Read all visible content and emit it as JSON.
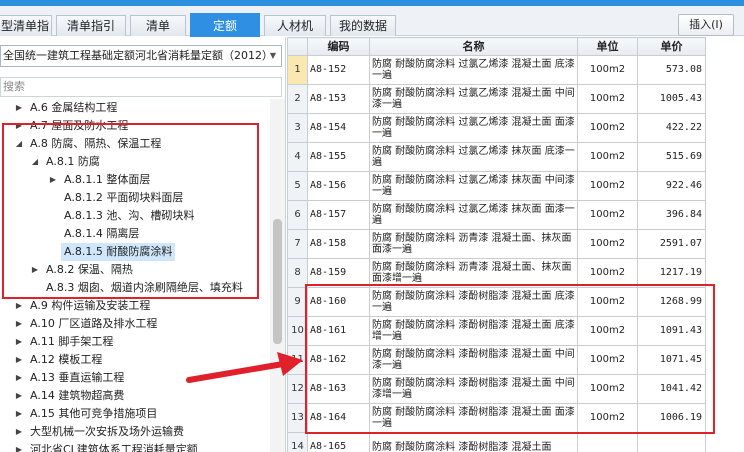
{
  "tabs": [
    {
      "label": "型清单指引",
      "active": false
    },
    {
      "label": "清单指引",
      "active": false
    },
    {
      "label": "清单",
      "active": false
    },
    {
      "label": "定额",
      "active": true
    },
    {
      "label": "人材机",
      "active": false
    },
    {
      "label": "我的数据",
      "active": false
    }
  ],
  "toolbar": {
    "insert_label": "插入(I)"
  },
  "library": {
    "selected": "全国统一建筑工程基础定额河北省消耗量定额（2012）"
  },
  "search": {
    "placeholder": "搜索"
  },
  "tree": [
    {
      "label": "A.6 金属结构工程",
      "toggle": "▶"
    },
    {
      "label": "A.7 屋面及防水工程",
      "toggle": "▶"
    },
    {
      "label": "A.8 防腐、隔热、保温工程",
      "toggle": "◢"
    },
    {
      "label": "A.8.1 防腐",
      "toggle": "◢"
    },
    {
      "label": "A.8.1.1 整体面层",
      "toggle": "▶"
    },
    {
      "label": "A.8.1.2 平面砌块料面层",
      "toggle": ""
    },
    {
      "label": "A.8.1.3 池、沟、槽砌块料",
      "toggle": ""
    },
    {
      "label": "A.8.1.4 隔离层",
      "toggle": ""
    },
    {
      "label": "A.8.1.5 耐酸防腐涂料",
      "toggle": "",
      "selected": true
    },
    {
      "label": "A.8.2 保温、隔热",
      "toggle": "▶"
    },
    {
      "label": "A.8.3 烟囱、烟道内涂刷隔绝层、填充料",
      "toggle": ""
    },
    {
      "label": "A.9 构件运输及安装工程",
      "toggle": "▶"
    },
    {
      "label": "A.10 厂区道路及排水工程",
      "toggle": "▶"
    },
    {
      "label": "A.11 脚手架工程",
      "toggle": "▶"
    },
    {
      "label": "A.12 模板工程",
      "toggle": "▶"
    },
    {
      "label": "A.13 垂直运输工程",
      "toggle": "▶"
    },
    {
      "label": "A.14 建筑物超高费",
      "toggle": "▶"
    },
    {
      "label": "A.15 其他可竞争措施项目",
      "toggle": "▶"
    },
    {
      "label": "大型机械一次安拆及场外运输费",
      "toggle": "▶"
    },
    {
      "label": "河北省CL建筑体系工程消耗量定额",
      "toggle": "▶"
    }
  ],
  "grid": {
    "headers": {
      "idx": "",
      "code": "编码",
      "name": "名称",
      "unit": "单位",
      "price": "单价"
    },
    "rows": [
      {
        "idx": "1",
        "code": "A8-152",
        "name": "防腐 耐酸防腐涂料 过氯乙烯漆 混凝土面 底漆一遍",
        "unit": "100m2",
        "price": "573.08"
      },
      {
        "idx": "2",
        "code": "A8-153",
        "name": "防腐 耐酸防腐涂料 过氯乙烯漆 混凝土面 中间漆一遍",
        "unit": "100m2",
        "price": "1005.43"
      },
      {
        "idx": "3",
        "code": "A8-154",
        "name": "防腐 耐酸防腐涂料 过氯乙烯漆 混凝土面 面漆一遍",
        "unit": "100m2",
        "price": "422.22"
      },
      {
        "idx": "4",
        "code": "A8-155",
        "name": "防腐 耐酸防腐涂料 过氯乙烯漆 抹灰面 底漆一遍",
        "unit": "100m2",
        "price": "515.69"
      },
      {
        "idx": "5",
        "code": "A8-156",
        "name": "防腐 耐酸防腐涂料 过氯乙烯漆 抹灰面 中间漆一遍",
        "unit": "100m2",
        "price": "922.46"
      },
      {
        "idx": "6",
        "code": "A8-157",
        "name": "防腐 耐酸防腐涂料 过氯乙烯漆 抹灰面 面漆一遍",
        "unit": "100m2",
        "price": "396.84"
      },
      {
        "idx": "7",
        "code": "A8-158",
        "name": "防腐 耐酸防腐涂料 沥青漆 混凝土面、抹灰面 面漆一遍",
        "unit": "100m2",
        "price": "2591.07"
      },
      {
        "idx": "8",
        "code": "A8-159",
        "name": "防腐 耐酸防腐涂料 沥青漆 混凝土面、抹灰面 面漆增一遍",
        "unit": "100m2",
        "price": "1217.19"
      },
      {
        "idx": "9",
        "code": "A8-160",
        "name": "防腐 耐酸防腐涂料 漆酚树脂漆 混凝土面 底漆一遍",
        "unit": "100m2",
        "price": "1268.99"
      },
      {
        "idx": "10",
        "code": "A8-161",
        "name": "防腐 耐酸防腐涂料 漆酚树脂漆 混凝土面 底漆增一遍",
        "unit": "100m2",
        "price": "1091.43"
      },
      {
        "idx": "11",
        "code": "A8-162",
        "name": "防腐 耐酸防腐涂料 漆酚树脂漆 混凝土面 中间漆一遍",
        "unit": "100m2",
        "price": "1071.45"
      },
      {
        "idx": "12",
        "code": "A8-163",
        "name": "防腐 耐酸防腐涂料 漆酚树脂漆 混凝土面 中间漆增一遍",
        "unit": "100m2",
        "price": "1041.42"
      },
      {
        "idx": "13",
        "code": "A8-164",
        "name": "防腐 耐酸防腐涂料 漆酚树脂漆 混凝土面 面漆一遍",
        "unit": "100m2",
        "price": "1006.19"
      },
      {
        "idx": "14",
        "code": "A8-165",
        "name": "防腐 耐酸防腐涂料 漆酚树脂漆 混凝土面",
        "unit": "",
        "price": ""
      }
    ]
  },
  "colors": {
    "accent": "#2f8fe3",
    "annotation": "#e0202a",
    "selection": "#cfe6fb"
  }
}
